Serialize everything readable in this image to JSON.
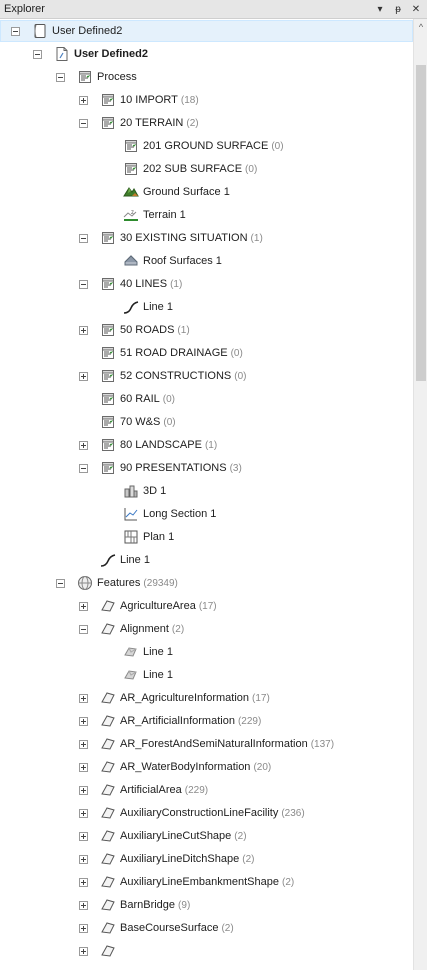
{
  "panel": {
    "title": "Explorer",
    "buttons": {
      "dropdown": "▾",
      "pin": "ᵽ",
      "close": "✕"
    }
  },
  "tree": {
    "rows": [
      {
        "level": 0,
        "expander": "minus",
        "icon": "document-icon",
        "label": "User Defined2",
        "bold": false,
        "count": "",
        "selected": true
      },
      {
        "level": 1,
        "expander": "minus",
        "icon": "file-icon",
        "label": "User Defined2",
        "bold": true,
        "count": ""
      },
      {
        "level": 2,
        "expander": "minus",
        "icon": "process-icon",
        "label": "Process",
        "bold": false,
        "count": ""
      },
      {
        "level": 3,
        "expander": "plus",
        "icon": "process-icon",
        "label": "10 IMPORT",
        "bold": false,
        "count": "(18)"
      },
      {
        "level": 3,
        "expander": "minus",
        "icon": "process-icon",
        "label": "20 TERRAIN",
        "bold": false,
        "count": "(2)"
      },
      {
        "level": 4,
        "expander": "none",
        "icon": "process-icon",
        "label": "201 GROUND SURFACE",
        "bold": false,
        "count": "(0)"
      },
      {
        "level": 4,
        "expander": "none",
        "icon": "process-icon",
        "label": "202 SUB SURFACE",
        "bold": false,
        "count": "(0)"
      },
      {
        "level": 4,
        "expander": "none",
        "icon": "ground-surface-icon",
        "label": "Ground Surface 1",
        "bold": false,
        "count": ""
      },
      {
        "level": 4,
        "expander": "none",
        "icon": "terrain-icon",
        "label": "Terrain 1",
        "bold": false,
        "count": ""
      },
      {
        "level": 3,
        "expander": "minus",
        "icon": "process-icon",
        "label": "30 EXISTING SITUATION",
        "bold": false,
        "count": "(1)"
      },
      {
        "level": 4,
        "expander": "none",
        "icon": "roof-surface-icon",
        "label": "Roof Surfaces 1",
        "bold": false,
        "count": ""
      },
      {
        "level": 3,
        "expander": "minus",
        "icon": "process-icon",
        "label": "40 LINES",
        "bold": false,
        "count": "(1)"
      },
      {
        "level": 4,
        "expander": "none",
        "icon": "line-icon",
        "label": "Line 1",
        "bold": false,
        "count": ""
      },
      {
        "level": 3,
        "expander": "plus",
        "icon": "process-icon",
        "label": "50 ROADS",
        "bold": false,
        "count": "(1)"
      },
      {
        "level": 3,
        "expander": "none",
        "icon": "process-icon",
        "label": "51 ROAD DRAINAGE",
        "bold": false,
        "count": "(0)"
      },
      {
        "level": 3,
        "expander": "plus",
        "icon": "process-icon",
        "label": "52 CONSTRUCTIONS",
        "bold": false,
        "count": "(0)"
      },
      {
        "level": 3,
        "expander": "none",
        "icon": "process-icon",
        "label": "60 RAIL",
        "bold": false,
        "count": "(0)"
      },
      {
        "level": 3,
        "expander": "none",
        "icon": "process-icon",
        "label": "70 W&S",
        "bold": false,
        "count": "(0)"
      },
      {
        "level": 3,
        "expander": "plus",
        "icon": "process-icon",
        "label": "80 LANDSCAPE",
        "bold": false,
        "count": "(1)"
      },
      {
        "level": 3,
        "expander": "minus",
        "icon": "process-icon",
        "label": "90 PRESENTATIONS",
        "bold": false,
        "count": "(3)"
      },
      {
        "level": 4,
        "expander": "none",
        "icon": "3d-view-icon",
        "label": "3D 1",
        "bold": false,
        "count": ""
      },
      {
        "level": 4,
        "expander": "none",
        "icon": "long-section-icon",
        "label": "Long Section 1",
        "bold": false,
        "count": ""
      },
      {
        "level": 4,
        "expander": "none",
        "icon": "plan-icon",
        "label": "Plan 1",
        "bold": false,
        "count": ""
      },
      {
        "level": 3,
        "expander": "none",
        "icon": "line-icon",
        "label": "Line 1",
        "bold": false,
        "count": ""
      },
      {
        "level": 2,
        "expander": "minus",
        "icon": "globe-icon",
        "label": "Features",
        "bold": false,
        "count": "(29349)"
      },
      {
        "level": 3,
        "expander": "plus",
        "icon": "feature-icon",
        "label": "AgricultureArea",
        "bold": false,
        "count": "(17)"
      },
      {
        "level": 3,
        "expander": "minus",
        "icon": "feature-icon",
        "label": "Alignment",
        "bold": false,
        "count": "(2)"
      },
      {
        "level": 4,
        "expander": "none",
        "icon": "feature-object-icon",
        "label": "Line 1",
        "bold": false,
        "count": ""
      },
      {
        "level": 4,
        "expander": "none",
        "icon": "feature-object-icon",
        "label": "Line 1",
        "bold": false,
        "count": ""
      },
      {
        "level": 3,
        "expander": "plus",
        "icon": "feature-icon",
        "label": "AR_AgricultureInformation",
        "bold": false,
        "count": "(17)"
      },
      {
        "level": 3,
        "expander": "plus",
        "icon": "feature-icon",
        "label": "AR_ArtificialInformation",
        "bold": false,
        "count": "(229)"
      },
      {
        "level": 3,
        "expander": "plus",
        "icon": "feature-icon",
        "label": "AR_ForestAndSemiNaturalInformation",
        "bold": false,
        "count": "(137)"
      },
      {
        "level": 3,
        "expander": "plus",
        "icon": "feature-icon",
        "label": "AR_WaterBodyInformation",
        "bold": false,
        "count": "(20)"
      },
      {
        "level": 3,
        "expander": "plus",
        "icon": "feature-icon",
        "label": "ArtificialArea",
        "bold": false,
        "count": "(229)"
      },
      {
        "level": 3,
        "expander": "plus",
        "icon": "feature-icon",
        "label": "AuxiliaryConstructionLineFacility",
        "bold": false,
        "count": "(236)"
      },
      {
        "level": 3,
        "expander": "plus",
        "icon": "feature-icon",
        "label": "AuxiliaryLineCutShape",
        "bold": false,
        "count": "(2)"
      },
      {
        "level": 3,
        "expander": "plus",
        "icon": "feature-icon",
        "label": "AuxiliaryLineDitchShape",
        "bold": false,
        "count": "(2)"
      },
      {
        "level": 3,
        "expander": "plus",
        "icon": "feature-icon",
        "label": "AuxiliaryLineEmbankmentShape",
        "bold": false,
        "count": "(2)"
      },
      {
        "level": 3,
        "expander": "plus",
        "icon": "feature-icon",
        "label": "BarnBridge",
        "bold": false,
        "count": "(9)"
      },
      {
        "level": 3,
        "expander": "plus",
        "icon": "feature-icon",
        "label": "BaseCourseSurface",
        "bold": false,
        "count": "(2)"
      },
      {
        "level": 3,
        "expander": "plus",
        "icon": "feature-icon",
        "label": "",
        "bold": false,
        "count": ""
      }
    ]
  },
  "scrollbar": {
    "up_arrow": "^"
  }
}
